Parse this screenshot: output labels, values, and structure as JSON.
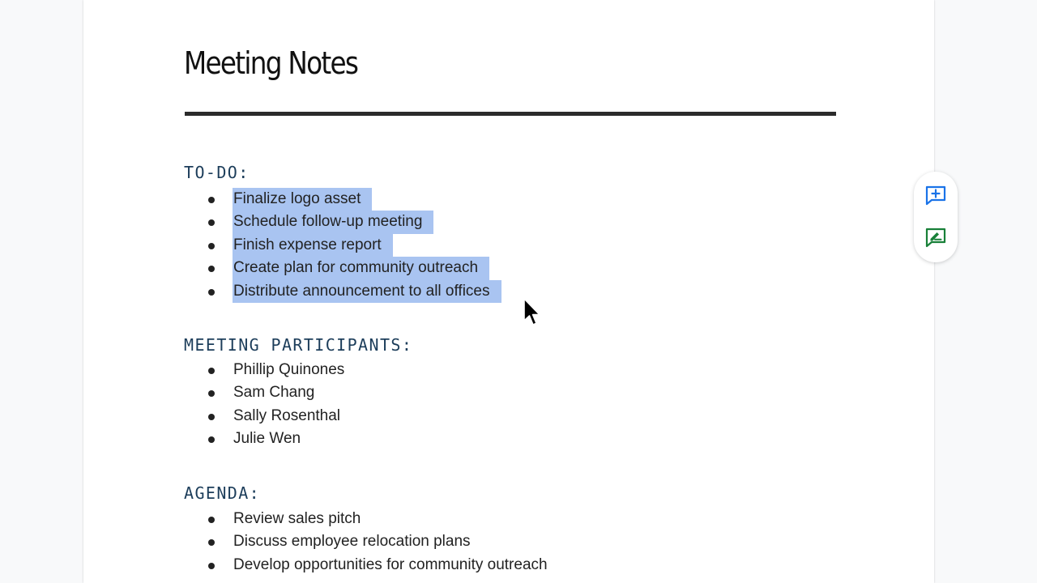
{
  "document": {
    "title": "Meeting Notes",
    "sections": [
      {
        "heading": "TO-DO:",
        "items": [
          "Finalize logo asset",
          "Schedule follow-up meeting",
          "Finish expense report",
          "Create plan for community outreach",
          "Distribute announcement to all offices"
        ],
        "selected": true
      },
      {
        "heading": "MEETING PARTICIPANTS:",
        "items": [
          "Phillip Quinones",
          "Sam Chang",
          "Sally Rosenthal",
          "Julie Wen"
        ],
        "selected": false
      },
      {
        "heading": "AGENDA:",
        "items": [
          "Review sales pitch",
          "Discuss employee relocation plans",
          "Develop opportunities for community outreach"
        ],
        "selected": false
      }
    ]
  },
  "side_actions": [
    {
      "icon": "add-comment-icon",
      "color": "#1a73e8"
    },
    {
      "icon": "suggest-edits-icon",
      "color": "#188038"
    }
  ],
  "colors": {
    "selection": "#a9c4f1",
    "heading": "#1c3d5a",
    "rule": "#2b2b2b"
  }
}
